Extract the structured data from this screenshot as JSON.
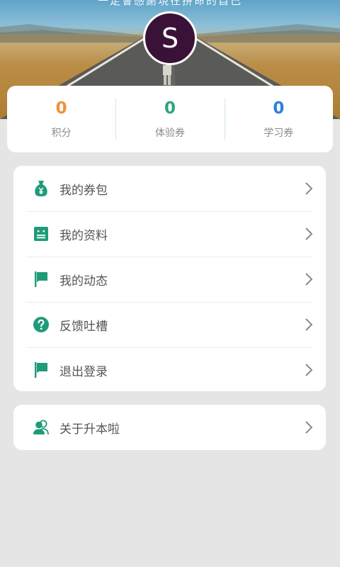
{
  "header": {
    "motto": "一定會感謝現在拼命的自己",
    "avatar_letter": "S"
  },
  "stats": [
    {
      "value": "0",
      "label": "积分",
      "color": "#f0913a"
    },
    {
      "value": "0",
      "label": "体验券",
      "color": "#2aa57f"
    },
    {
      "value": "0",
      "label": "学习券",
      "color": "#2b7fe2"
    }
  ],
  "menu": [
    {
      "label": "我的券包",
      "icon": "money-bag-icon"
    },
    {
      "label": "我的资料",
      "icon": "profile-card-icon"
    },
    {
      "label": "我的动态",
      "icon": "flag-icon"
    },
    {
      "label": "反馈吐槽",
      "icon": "question-icon"
    },
    {
      "label": "退出登录",
      "icon": "flag-icon"
    }
  ],
  "about": {
    "label": "关于升本啦",
    "icon": "users-icon"
  },
  "theme": {
    "accent": "#1f9b7a"
  }
}
